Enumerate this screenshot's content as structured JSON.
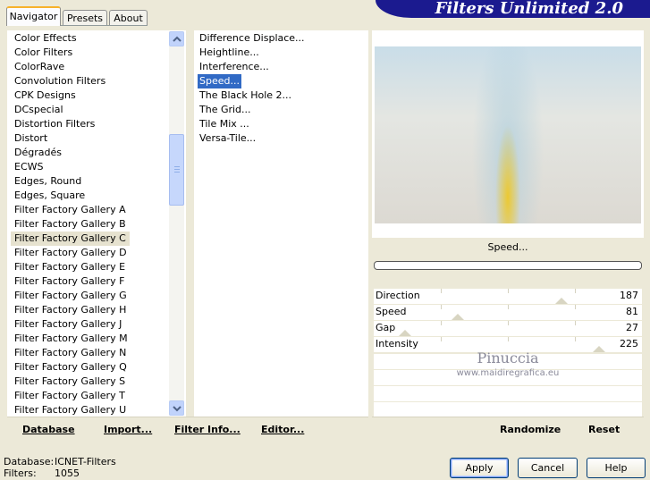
{
  "tabs": [
    {
      "label": "Navigator",
      "active": true
    },
    {
      "label": "Presets",
      "active": false
    },
    {
      "label": "About",
      "active": false
    }
  ],
  "app_title": "Filters Unlimited 2.0",
  "categories": [
    "Color Effects",
    "Color Filters",
    "ColorRave",
    "Convolution Filters",
    "CPK Designs",
    "DCspecial",
    "Distortion Filters",
    "Distort",
    "Dégradés",
    "ECWS",
    "Edges, Round",
    "Edges, Square",
    "Filter Factory Gallery A",
    "Filter Factory Gallery B",
    "Filter Factory Gallery C",
    "Filter Factory Gallery D",
    "Filter Factory Gallery E",
    "Filter Factory Gallery F",
    "Filter Factory Gallery G",
    "Filter Factory Gallery H",
    "Filter Factory Gallery J",
    "Filter Factory Gallery M",
    "Filter Factory Gallery N",
    "Filter Factory Gallery Q",
    "Filter Factory Gallery S",
    "Filter Factory Gallery T",
    "Filter Factory Gallery U"
  ],
  "selected_category_index": 14,
  "filters": [
    "Difference Displace...",
    "Heightline...",
    "Interference...",
    "Speed...",
    "The Black Hole 2...",
    "The Grid...",
    "Tile Mix ...",
    "Versa-Tile..."
  ],
  "selected_filter_index": 3,
  "left_buttons": {
    "database": "Database",
    "import": "Import...",
    "filter_info": "Filter Info...",
    "editor": "Editor..."
  },
  "preview": {
    "filter_name": "Speed...",
    "watermark_name": "Pinuccia",
    "watermark_url": "www.maidiregrafica.eu"
  },
  "parameters": [
    {
      "label": "Direction",
      "value": "187"
    },
    {
      "label": "Speed",
      "value": "81"
    },
    {
      "label": "Gap",
      "value": "27"
    },
    {
      "label": "Intensity",
      "value": "225"
    }
  ],
  "right_buttons": {
    "randomize": "Randomize",
    "reset": "Reset"
  },
  "status": {
    "database_label": "Database:",
    "database_value": "ICNET-Filters",
    "filters_label": "Filters:",
    "filters_value": "1055"
  },
  "dialog_buttons": {
    "apply": "Apply",
    "cancel": "Cancel",
    "help": "Help"
  },
  "colors": {
    "selection": "#316ac5",
    "banner": "#1b1a8f",
    "tab_accent": "#f7b22b"
  },
  "scroll_icons": {
    "up": "chevron-up-icon",
    "down": "chevron-down-icon"
  }
}
